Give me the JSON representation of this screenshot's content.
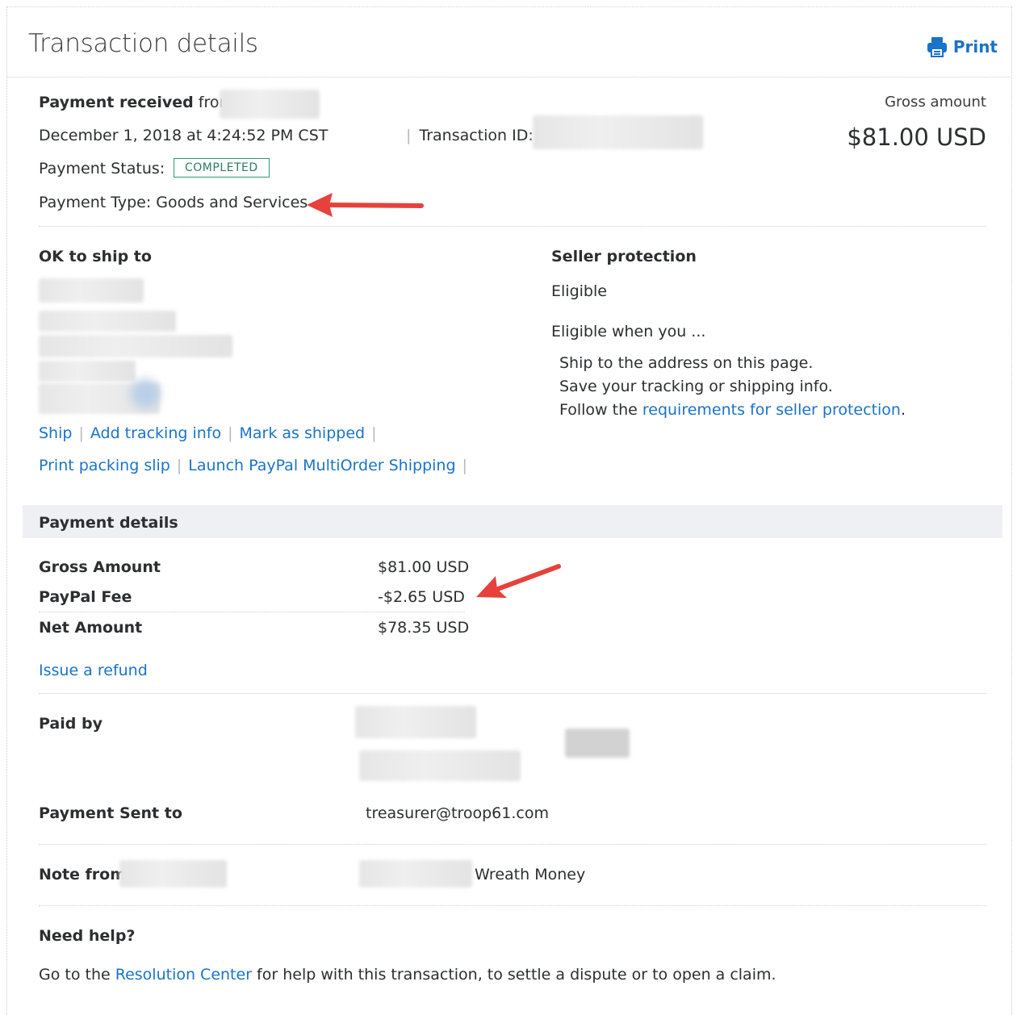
{
  "header": {
    "title": "Transaction details",
    "print_label": "Print"
  },
  "summary": {
    "payment_received_bold": "Payment received",
    "payment_received_from": "from",
    "date": "December 1, 2018 at 4:24:52 PM CST",
    "transaction_id_label": "Transaction ID:",
    "status_label": "Payment Status:",
    "status_badge": "COMPLETED",
    "type_label": "Payment Type: Goods and Services",
    "gross_label": "Gross amount",
    "gross_value": "$81.00 USD"
  },
  "ship": {
    "heading": "OK to ship to",
    "actions_row1": [
      "Ship",
      "Add tracking info",
      "Mark as shipped"
    ],
    "actions_row2": [
      "Print packing slip",
      "Launch PayPal MultiOrder Shipping"
    ]
  },
  "seller_protection": {
    "heading": "Seller protection",
    "status": "Eligible",
    "when": "Eligible when you ...",
    "line1": "Ship to the address on this page.",
    "line2": "Save your tracking or shipping info.",
    "line3_prefix": "Follow the",
    "line3_link": "requirements for seller protection",
    "line3_suffix": "."
  },
  "payment_details": {
    "heading": "Payment details",
    "rows": [
      {
        "label": "Gross Amount",
        "value": "$81.00 USD"
      },
      {
        "label": "PayPal Fee",
        "value": "-$2.65 USD"
      },
      {
        "label": "Net Amount",
        "value": "$78.35 USD"
      }
    ],
    "refund_link": "Issue a refund"
  },
  "paid_by": {
    "label": "Paid by"
  },
  "payment_sent_to": {
    "label": "Payment Sent to",
    "value": "treasurer@troop61.com"
  },
  "note": {
    "label": "Note from",
    "value": "Wreath Money"
  },
  "help": {
    "heading": "Need help?",
    "prefix": "Go to the",
    "link": "Resolution Center",
    "suffix": "for help with this transaction, to settle a dispute or to open a claim."
  },
  "colors": {
    "link": "#1a73c7",
    "badge": "#2d9a6b",
    "arrow": "#e8413c",
    "band": "#eef0f4"
  }
}
